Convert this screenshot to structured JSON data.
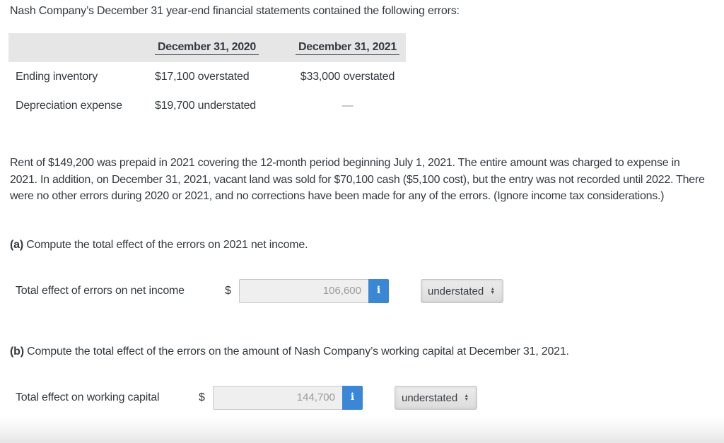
{
  "intro": "Nash Company’s December 31 year-end financial statements contained the following errors:",
  "error_table": {
    "headers": [
      "",
      "December 31, 2020",
      "December 31, 2021"
    ],
    "rows": [
      {
        "label": "Ending inventory",
        "y2020": "$17,100 overstated",
        "y2021": "$33,000 overstated"
      },
      {
        "label": "Depreciation expense",
        "y2020": "$19,700 understated",
        "y2021": "—"
      }
    ]
  },
  "paragraph": "Rent of $149,200 was prepaid in 2021 covering the 12-month period beginning July 1, 2021. The entire amount was charged to expense in 2021. In addition, on December 31, 2021, vacant land was sold for $70,100 cash ($5,100 cost), but the entry was not recorded until 2022. There were no other errors during 2020 or 2021, and no corrections have been made for any of the errors. (Ignore income tax considerations.)",
  "part_a": {
    "tag": "(a)",
    "question": " Compute the total effect of the errors on 2021 net income.",
    "field_label": "Total effect of errors on net income",
    "currency": "$",
    "value": "106,600",
    "info_icon": "i",
    "select_value": "understated"
  },
  "part_b": {
    "tag": "(b)",
    "question": " Compute the total effect of the errors on the amount of Nash Company’s working capital at December 31, 2021.",
    "field_label": "Total effect on working capital",
    "currency": "$",
    "value": "144,700",
    "info_icon": "i",
    "select_value": "understated"
  },
  "colors": {
    "info_button": "#3a87d7",
    "table_header_bg": "#e6e6e6"
  }
}
